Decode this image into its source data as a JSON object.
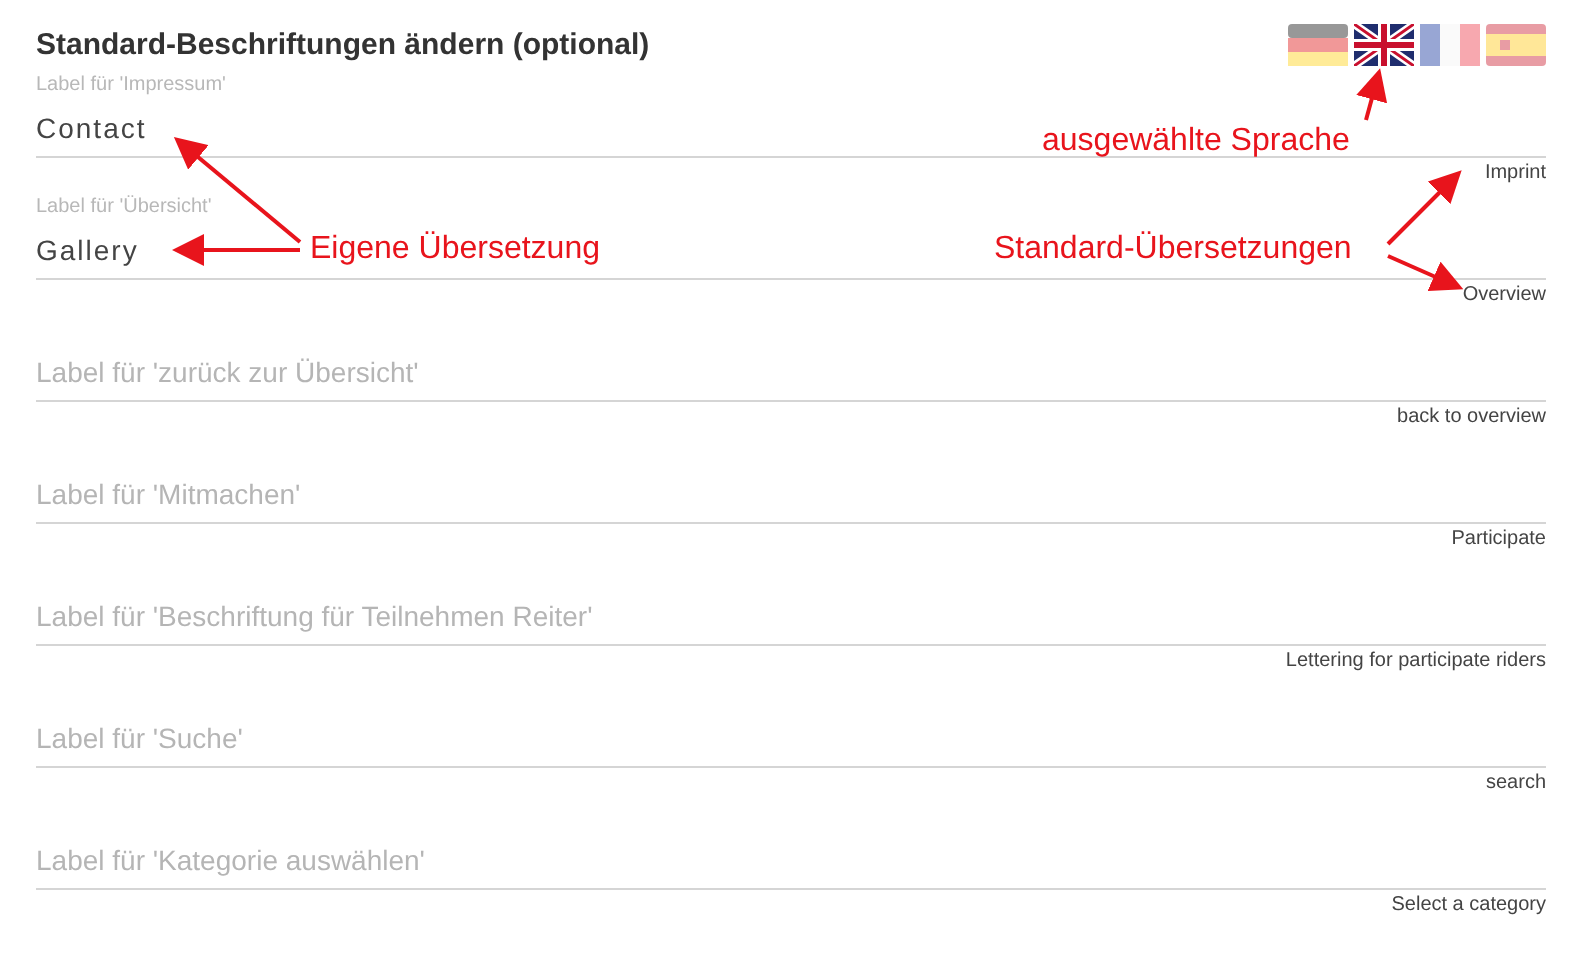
{
  "title": "Standard-Beschriftungen ändern (optional)",
  "languages": [
    {
      "kind": "de",
      "selected": false
    },
    {
      "kind": "gb",
      "selected": true
    },
    {
      "kind": "fr",
      "selected": false
    },
    {
      "kind": "es",
      "selected": false
    }
  ],
  "fields": [
    {
      "label": "Label für 'Impressum'",
      "value": "Contact",
      "hint": "Imprint"
    },
    {
      "label": "Label für 'Übersicht'",
      "value": "Gallery",
      "hint": "Overview"
    },
    {
      "placeholder": "Label für 'zurück zur Übersicht'",
      "hint": "back to overview"
    },
    {
      "placeholder": "Label für 'Mitmachen'",
      "hint": "Participate"
    },
    {
      "placeholder": "Label für 'Beschriftung für Teilnehmen Reiter'",
      "hint": "Lettering for participate riders"
    },
    {
      "placeholder": "Label für 'Suche'",
      "hint": "search"
    },
    {
      "placeholder": "Label für 'Kategorie auswählen'",
      "hint": "Select a category"
    }
  ],
  "annotations": [
    {
      "kind": "language",
      "text": "ausgewählte Sprache"
    },
    {
      "kind": "own",
      "text": "Eigene Übersetzung"
    },
    {
      "kind": "standard",
      "text": "Standard-Übersetzungen"
    }
  ]
}
